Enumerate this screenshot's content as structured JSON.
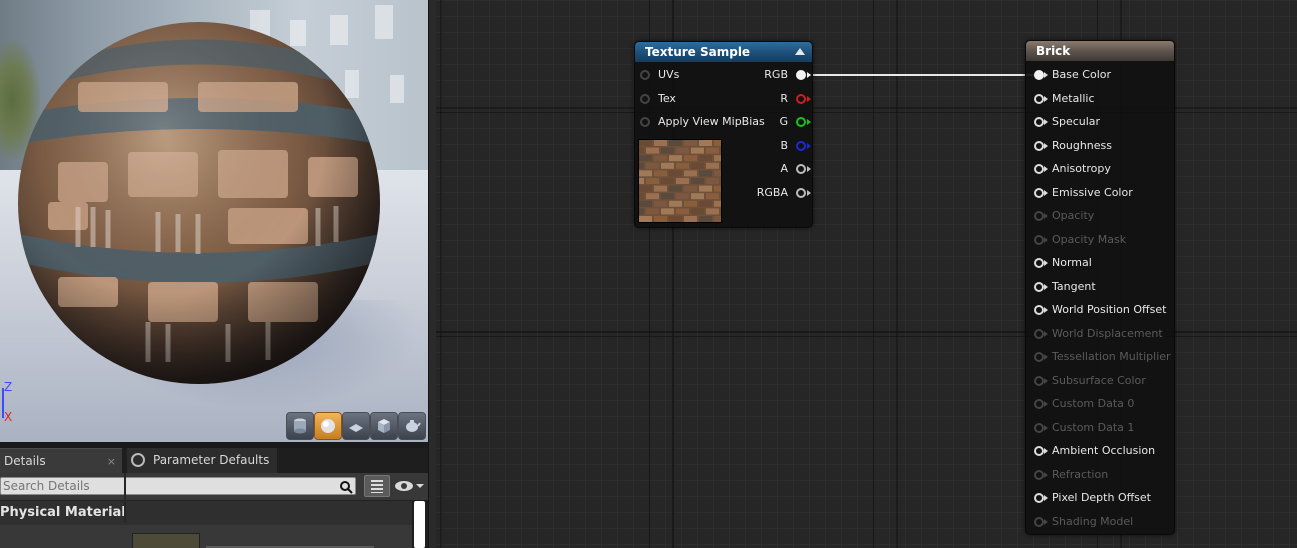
{
  "viewport": {
    "axis_z": "Z",
    "axis_x": "X",
    "view_buttons": [
      {
        "icon": "cylinder-icon",
        "active": false
      },
      {
        "icon": "sphere-icon",
        "active": true
      },
      {
        "icon": "plane-icon",
        "active": false
      },
      {
        "icon": "cube-icon",
        "active": false
      },
      {
        "icon": "teapot-icon",
        "active": false
      }
    ]
  },
  "tabs": {
    "details_label": "Details",
    "details_close": "×",
    "params_label": "Parameter Defaults"
  },
  "details": {
    "search_placeholder": "Search Details",
    "category_label": "Physical Material"
  },
  "texture_node": {
    "title": "Texture Sample",
    "inputs": [
      "UVs",
      "Tex",
      "Apply View MipBias"
    ],
    "outputs": [
      {
        "label": "RGB",
        "color": "#f2f2f2",
        "connected": true
      },
      {
        "label": "R",
        "color": "#d21d1d",
        "connected": false
      },
      {
        "label": "G",
        "color": "#19c419",
        "connected": false
      },
      {
        "label": "B",
        "color": "#1b2ad6",
        "connected": false
      },
      {
        "label": "A",
        "color": "#bdbdbd",
        "connected": false
      },
      {
        "label": "RGBA",
        "color": "#bdbdbd",
        "connected": false
      }
    ]
  },
  "material_node": {
    "title": "Brick",
    "pins": [
      {
        "label": "Base Color",
        "enabled": true,
        "connected": true
      },
      {
        "label": "Metallic",
        "enabled": true,
        "connected": false
      },
      {
        "label": "Specular",
        "enabled": true,
        "connected": false
      },
      {
        "label": "Roughness",
        "enabled": true,
        "connected": false
      },
      {
        "label": "Anisotropy",
        "enabled": true,
        "connected": false
      },
      {
        "label": "Emissive Color",
        "enabled": true,
        "connected": false
      },
      {
        "label": "Opacity",
        "enabled": false,
        "connected": false
      },
      {
        "label": "Opacity Mask",
        "enabled": false,
        "connected": false
      },
      {
        "label": "Normal",
        "enabled": true,
        "connected": false
      },
      {
        "label": "Tangent",
        "enabled": true,
        "connected": false
      },
      {
        "label": "World Position Offset",
        "enabled": true,
        "connected": false
      },
      {
        "label": "World Displacement",
        "enabled": false,
        "connected": false
      },
      {
        "label": "Tessellation Multiplier",
        "enabled": false,
        "connected": false
      },
      {
        "label": "Subsurface Color",
        "enabled": false,
        "connected": false
      },
      {
        "label": "Custom Data 0",
        "enabled": false,
        "connected": false
      },
      {
        "label": "Custom Data 1",
        "enabled": false,
        "connected": false
      },
      {
        "label": "Ambient Occlusion",
        "enabled": true,
        "connected": false
      },
      {
        "label": "Refraction",
        "enabled": false,
        "connected": false
      },
      {
        "label": "Pixel Depth Offset",
        "enabled": true,
        "connected": false
      },
      {
        "label": "Shading Model",
        "enabled": false,
        "connected": false
      }
    ]
  },
  "colors": {
    "texture_header": "#1d4f78",
    "material_header": "#5e544d",
    "active_view_button": "#c57e20"
  }
}
